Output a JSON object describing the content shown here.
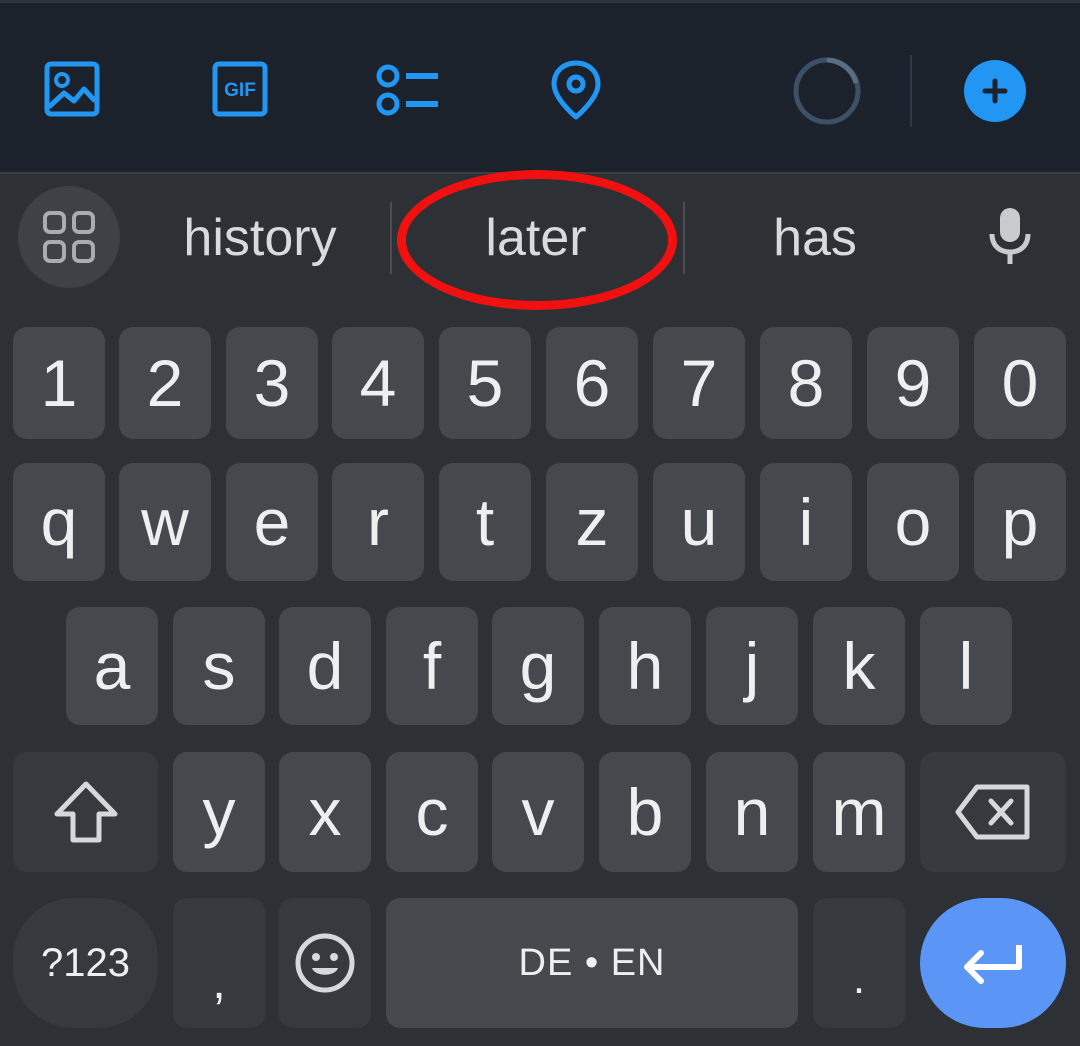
{
  "toolbar": {
    "icons": [
      "image-icon",
      "gif-icon",
      "list-icon",
      "location-pin-icon",
      "progress-ring-icon",
      "add-icon"
    ],
    "gif_text": "GIF",
    "accent_color": "#2196f3"
  },
  "suggestions": {
    "apps_icon": "grid-apps-icon",
    "items": [
      "history",
      "later",
      "has"
    ],
    "highlighted": "later",
    "highlight_color": "#f01010",
    "mic_icon": "mic-icon"
  },
  "keyboard": {
    "number_row": [
      "1",
      "2",
      "3",
      "4",
      "5",
      "6",
      "7",
      "8",
      "9",
      "0"
    ],
    "row1": [
      "q",
      "w",
      "e",
      "r",
      "t",
      "z",
      "u",
      "i",
      "o",
      "p"
    ],
    "row2": [
      "a",
      "s",
      "d",
      "f",
      "g",
      "h",
      "j",
      "k",
      "l"
    ],
    "row3": [
      "y",
      "x",
      "c",
      "v",
      "b",
      "n",
      "m"
    ],
    "shift_icon": "shift-icon",
    "backspace_icon": "backspace-icon",
    "symbols_label": "?123",
    "comma_label": ",",
    "emoji_icon": "emoji-icon",
    "space_label": "DE • EN",
    "period_label": ".",
    "enter_icon": "enter-icon",
    "enter_color": "#5b96f7"
  }
}
